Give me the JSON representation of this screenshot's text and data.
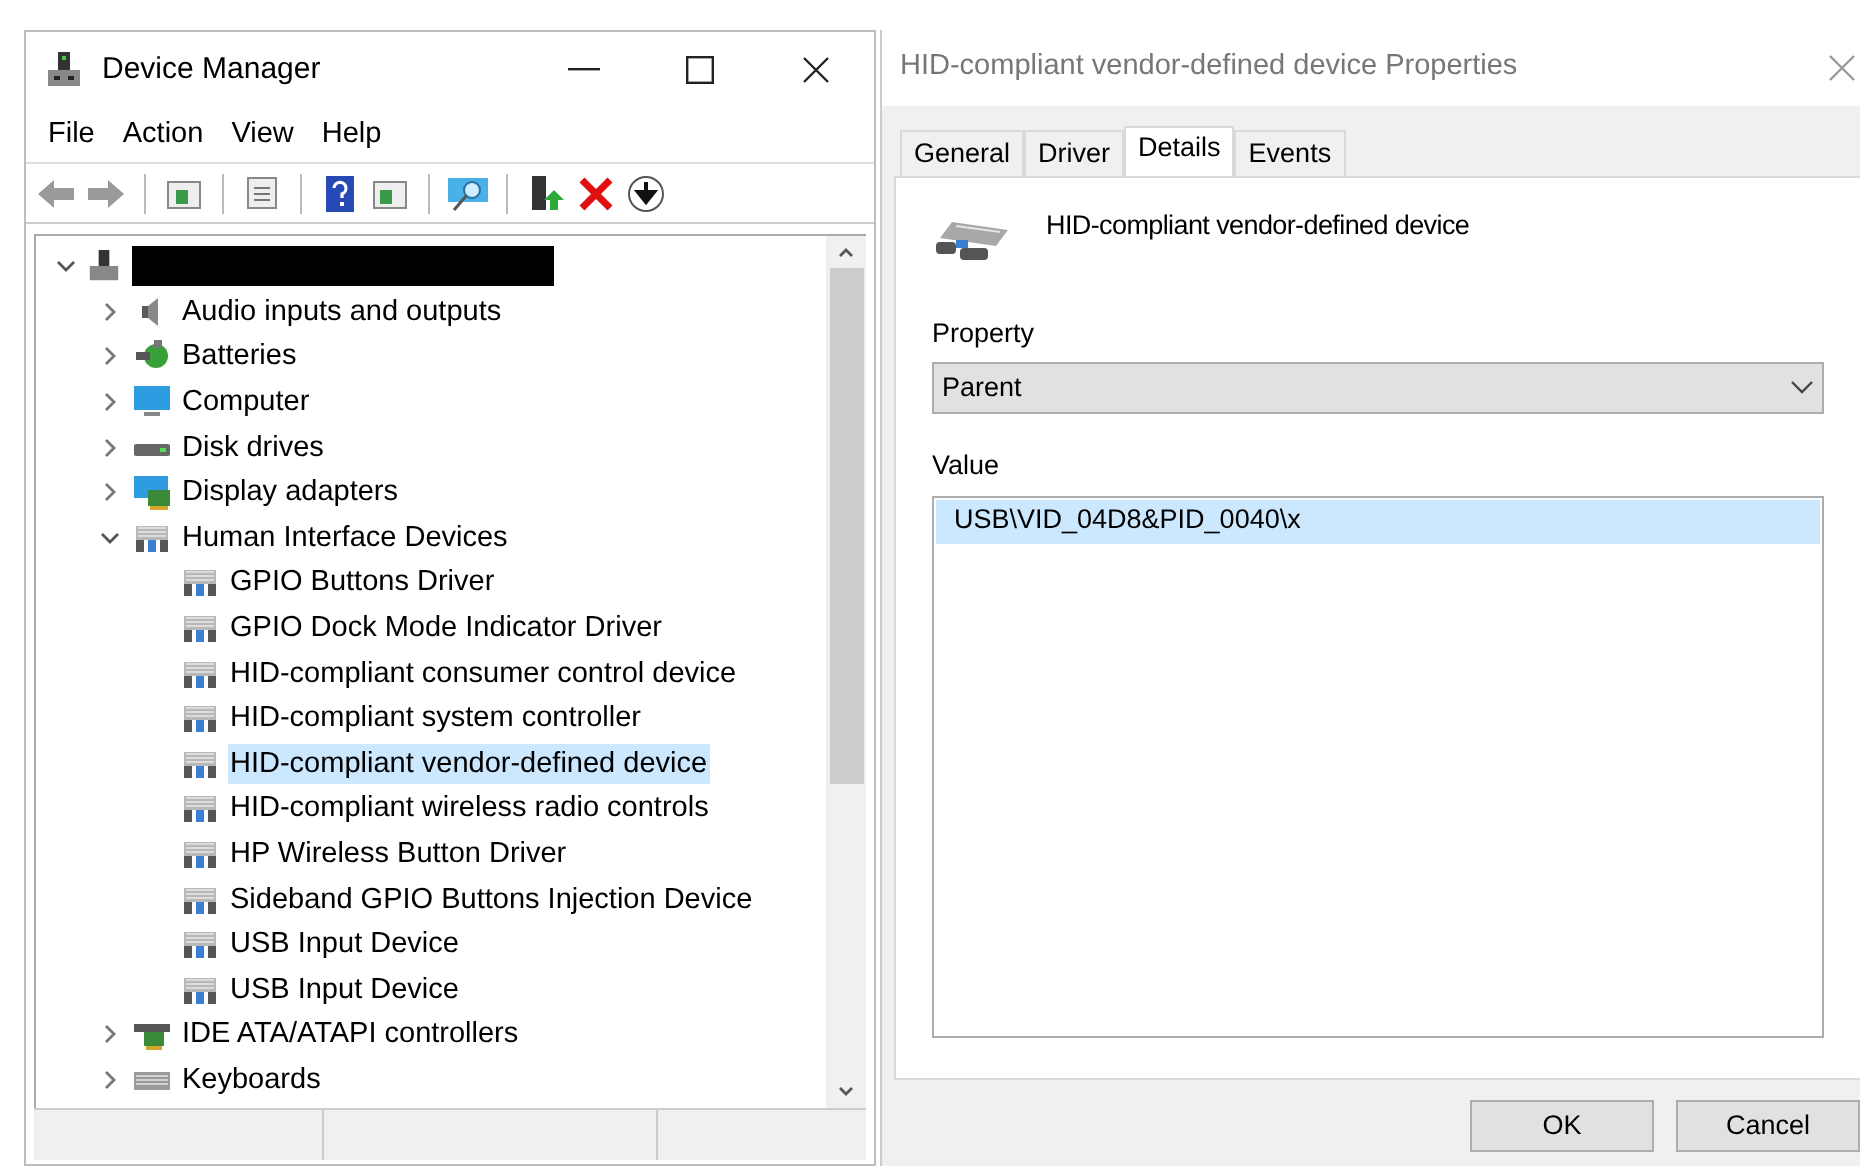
{
  "device_manager": {
    "title": "Device Manager",
    "menu": [
      "File",
      "Action",
      "View",
      "Help"
    ],
    "tree": {
      "expanded": true,
      "children": [
        {
          "label": "Audio inputs and outputs",
          "kind": "audio",
          "expanded": false,
          "selected": false
        },
        {
          "label": "Batteries",
          "kind": "battery",
          "expanded": false,
          "selected": false
        },
        {
          "label": "Computer",
          "kind": "monitor",
          "expanded": false,
          "selected": false
        },
        {
          "label": "Disk drives",
          "kind": "disk",
          "expanded": false,
          "selected": false
        },
        {
          "label": "Display adapters",
          "kind": "display",
          "expanded": false,
          "selected": false
        },
        {
          "label": "Human Interface Devices",
          "kind": "hid",
          "expanded": true,
          "selected": false,
          "children": [
            {
              "label": "GPIO Buttons Driver",
              "kind": "hid",
              "selected": false
            },
            {
              "label": "GPIO Dock Mode Indicator Driver",
              "kind": "hid",
              "selected": false
            },
            {
              "label": "HID-compliant consumer control device",
              "kind": "hid",
              "selected": false
            },
            {
              "label": "HID-compliant system controller",
              "kind": "hid",
              "selected": false
            },
            {
              "label": "HID-compliant vendor-defined device",
              "kind": "hid",
              "selected": true
            },
            {
              "label": "HID-compliant wireless radio controls",
              "kind": "hid",
              "selected": false
            },
            {
              "label": "HP Wireless Button Driver",
              "kind": "hid",
              "selected": false
            },
            {
              "label": "Sideband GPIO Buttons Injection Device",
              "kind": "hid",
              "selected": false
            },
            {
              "label": "USB Input Device",
              "kind": "hid",
              "selected": false
            },
            {
              "label": "USB Input Device",
              "kind": "hid",
              "selected": false
            }
          ]
        },
        {
          "label": "IDE ATA/ATAPI controllers",
          "kind": "controller",
          "expanded": false,
          "selected": false
        },
        {
          "label": "Keyboards",
          "kind": "keyboard",
          "expanded": false,
          "selected": false
        }
      ]
    }
  },
  "properties": {
    "title": "HID-compliant vendor-defined device Properties",
    "tabs": [
      {
        "label": "General",
        "selected": false
      },
      {
        "label": "Driver",
        "selected": false
      },
      {
        "label": "Details",
        "selected": true
      },
      {
        "label": "Events",
        "selected": false
      }
    ],
    "device_name": "HID-compliant vendor-defined device",
    "property_label": "Property",
    "property_value": "Parent",
    "value_label": "Value",
    "values": [
      {
        "text": "USB\\VID_04D8&PID_0040\\x",
        "selected": true
      }
    ],
    "buttons": [
      "OK",
      "Cancel"
    ]
  }
}
